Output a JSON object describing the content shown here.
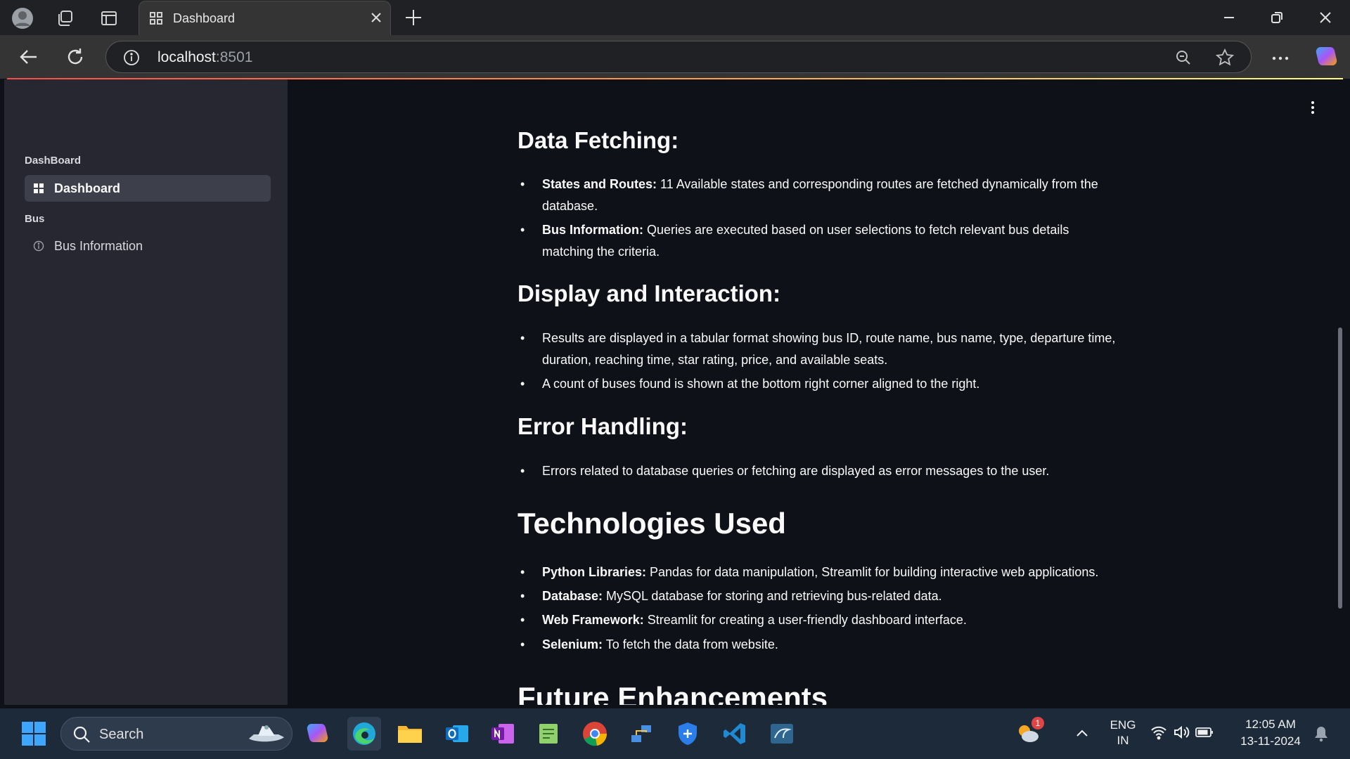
{
  "browser": {
    "tab_title": "Dashboard",
    "url_host": "localhost",
    "url_port": ":8501"
  },
  "sidebar": {
    "sections": [
      {
        "label": "DashBoard",
        "items": [
          {
            "label": "Dashboard",
            "icon": "dashboard-icon",
            "active": true
          }
        ]
      },
      {
        "label": "Bus",
        "items": [
          {
            "label": "Bus Information",
            "icon": "info-icon",
            "active": false
          }
        ]
      }
    ]
  },
  "main": {
    "data_fetching": {
      "heading": "Data Fetching:",
      "bullets": [
        {
          "bold": "States and Routes:",
          "text": " 11 Available states and corresponding routes are fetched dynamically from the database."
        },
        {
          "bold": "Bus Information:",
          "text": " Queries are executed based on user selections to fetch relevant bus details matching the criteria."
        }
      ]
    },
    "display": {
      "heading": "Display and Interaction:",
      "bullets": [
        {
          "bold": "",
          "text": "Results are displayed in a tabular format showing bus ID, route name, bus name, type, departure time, duration, reaching time, star rating, price, and available seats."
        },
        {
          "bold": "",
          "text": "A count of buses found is shown at the bottom right corner aligned to the right."
        }
      ]
    },
    "errors": {
      "heading": "Error Handling:",
      "bullets": [
        {
          "bold": "",
          "text": "Errors related to database queries or fetching are displayed as error messages to the user."
        }
      ]
    },
    "tech": {
      "heading": "Technologies Used",
      "bullets": [
        {
          "bold": "Python Libraries:",
          "text": " Pandas for data manipulation, Streamlit for building interactive web applications."
        },
        {
          "bold": "Database:",
          "text": " MySQL database for storing and retrieving bus-related data."
        },
        {
          "bold": "Web Framework:",
          "text": " Streamlit for creating a user-friendly dashboard interface."
        },
        {
          "bold": "Selenium:",
          "text": " To fetch the data from website."
        }
      ]
    },
    "future": {
      "heading": "Future Enhancements"
    }
  },
  "taskbar": {
    "search_label": "Search",
    "lang_1": "ENG",
    "lang_2": "IN",
    "time": "12:05 AM",
    "date": "13-11-2024",
    "weather_badge": "1"
  },
  "colors": {
    "accent_red": "#ff4b4b",
    "app_bg": "#0e1117",
    "sidebar_bg": "#262730"
  }
}
